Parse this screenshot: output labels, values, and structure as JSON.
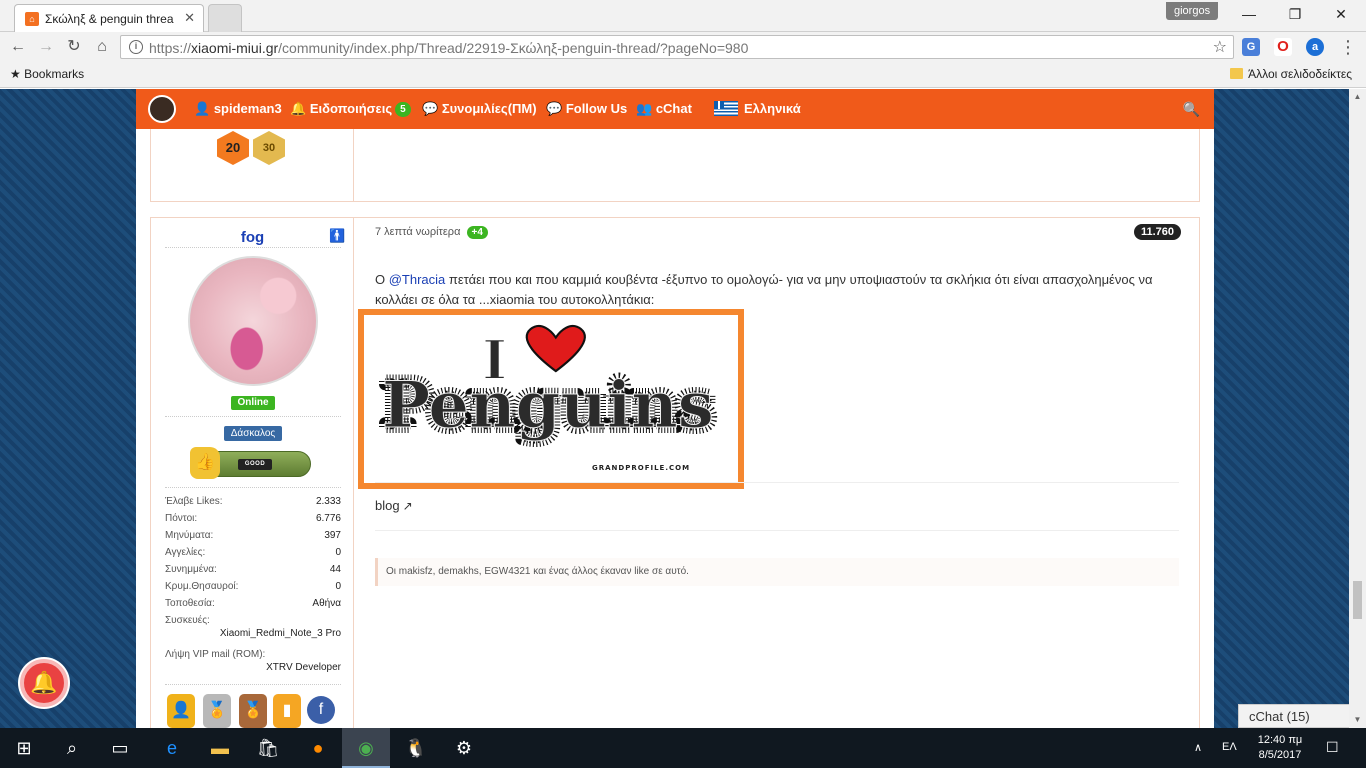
{
  "browser": {
    "tab_title": "Σκώληξ & penguin threa",
    "user_badge": "giorgos",
    "url_scheme": "https://",
    "url_host": "xiaomi-miui.gr",
    "url_path": "/community/index.php/Thread/22919-Σκώληξ-penguin-thread/?pageNo=980",
    "bookmarks_label": "Bookmarks",
    "other_bookmarks_label": "Άλλοι σελιδοδείκτες"
  },
  "site_nav": {
    "user": "spideman3",
    "notifications_label": "Ειδοποιήσεις",
    "notifications_count": "5",
    "conversations_label": "Συνομιλίες(ΠΜ)",
    "follow_label": "Follow Us",
    "cchat_label": "cChat",
    "language_label": "Ελληνικά"
  },
  "prev_post_badges": [
    "20",
    "30"
  ],
  "post": {
    "author": "fog",
    "online_label": "Online",
    "rank_label": "Δάσκαλος",
    "good_label": "GOOD",
    "stats": [
      {
        "key": "Έλαβε Likes:",
        "value": "2.333"
      },
      {
        "key": "Πόντοι:",
        "value": "6.776"
      },
      {
        "key": "Μηνύματα:",
        "value": "397"
      },
      {
        "key": "Αγγελίες:",
        "value": "0"
      },
      {
        "key": "Συνημμένα:",
        "value": "44"
      },
      {
        "key": "Κρυμ.Θησαυροί:",
        "value": "0"
      },
      {
        "key": "Τοποθεσία:",
        "value": "Αθήνα"
      }
    ],
    "devices_key": "Συσκευές:",
    "devices_value": "Xiaomi_Redmi_Note_3 Pro",
    "vip_key": "Λήψη VIP mail (ROM):",
    "vip_value": "XTRV Developer",
    "time": "7 λεπτά νωρίτερα",
    "likes_delta": "+4",
    "number": "11.760",
    "body_prefix": "Ο ",
    "mention": "@Thracia",
    "body_text": " πετάει που και που καμμιά κουβέντα -έξυπνο το ομολογώ- για να μην υποψιαστούν τα σκλήκια ότι είναι απασχολημένος να κολλάει σε όλα τα ...xiaomia του αυτοκολλητάκια:",
    "image_text_i": "I",
    "image_text_main": "Penguins",
    "image_credit": "GRANDPROFILE.COM",
    "blog_label": "blog",
    "likes_summary": "Οι makisfz, demakhs, EGW4321 και ένας άλλος έκαναν like σε αυτό."
  },
  "cchat_widget": "cChat (15)",
  "taskbar": {
    "language": "ΕΛ",
    "time": "12:40 πμ",
    "date": "8/5/2017"
  },
  "colors": {
    "brand_orange": "#f05a1a",
    "online_green": "#3cb521",
    "link_blue": "#1a3fb4"
  }
}
